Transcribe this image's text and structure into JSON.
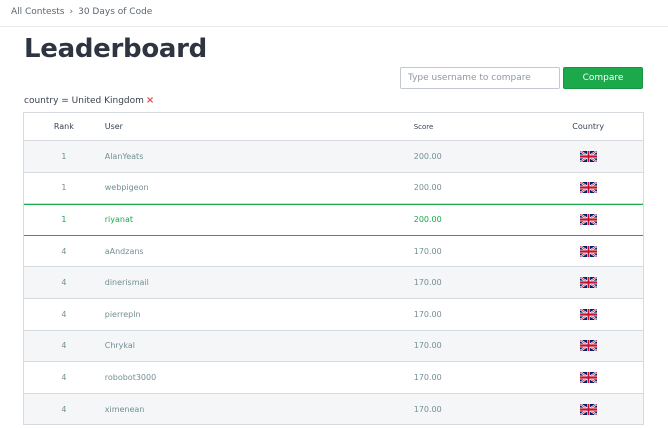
{
  "breadcrumb": {
    "items": [
      "All Contests",
      "30 Days of Code"
    ],
    "separator": "›"
  },
  "page": {
    "title": "Leaderboard"
  },
  "compare": {
    "placeholder": "Type username to compare",
    "button_label": "Compare"
  },
  "filter": {
    "text": "country = United Kingdom",
    "remove_label": "×"
  },
  "table": {
    "headers": {
      "rank": "Rank",
      "user": "User",
      "score": "Score",
      "country": "Country"
    },
    "rows": [
      {
        "rank": "1",
        "user": "AlanYeats",
        "score": "200.00",
        "country_icon": "uk-flag-icon"
      },
      {
        "rank": "1",
        "user": "webpigeon",
        "score": "200.00",
        "country_icon": "uk-flag-icon"
      },
      {
        "rank": "1",
        "user": "riyanat",
        "score": "200.00",
        "country_icon": "uk-flag-icon",
        "highlighted": true
      },
      {
        "rank": "4",
        "user": "aAndzans",
        "score": "170.00",
        "country_icon": "uk-flag-icon"
      },
      {
        "rank": "4",
        "user": "dinerismail",
        "score": "170.00",
        "country_icon": "uk-flag-icon"
      },
      {
        "rank": "4",
        "user": "pierrepln",
        "score": "170.00",
        "country_icon": "uk-flag-icon"
      },
      {
        "rank": "4",
        "user": "Chrykal",
        "score": "170.00",
        "country_icon": "uk-flag-icon"
      },
      {
        "rank": "4",
        "user": "robobot3000",
        "score": "170.00",
        "country_icon": "uk-flag-icon"
      },
      {
        "rank": "4",
        "user": "ximenean",
        "score": "170.00",
        "country_icon": "uk-flag-icon"
      }
    ]
  },
  "colors": {
    "accent": "#1ba94c",
    "remove": "#e5474b",
    "text": "#39424e",
    "muted": "#738f93"
  }
}
